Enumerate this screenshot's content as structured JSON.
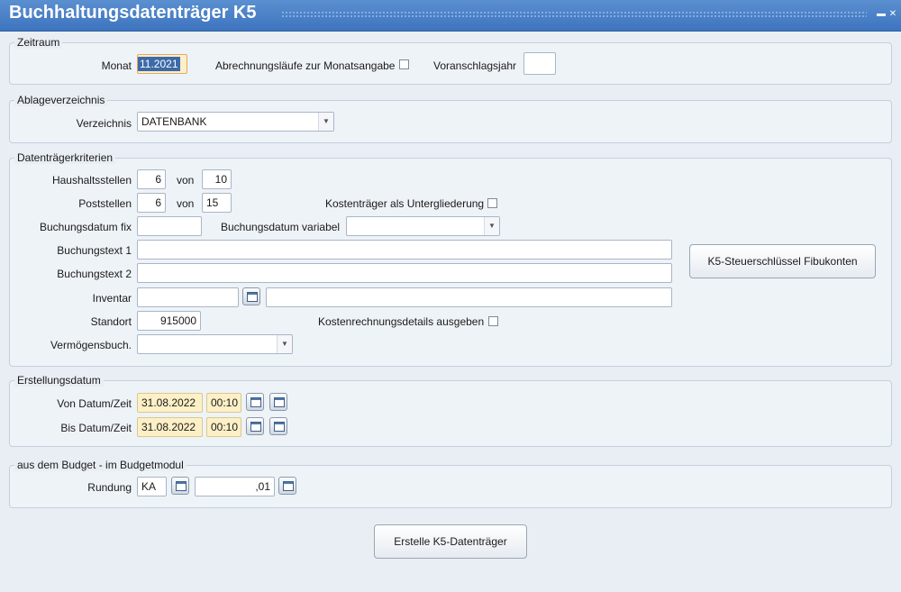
{
  "window": {
    "title": "Buchhaltungsdatenträger K5",
    "minimize_icon": "minimize-icon",
    "close_icon": "close-icon"
  },
  "zeitraum": {
    "legend": "Zeitraum",
    "monat_label": "Monat",
    "monat_value": "11.2021",
    "abrechnungslaeufe_label": "Abrechnungsläufe zur Monatsangabe",
    "voranschlagsjahr_label": "Voranschlagsjahr",
    "voranschlagsjahr_value": ""
  },
  "ablage": {
    "legend": "Ablageverzeichnis",
    "verzeichnis_label": "Verzeichnis",
    "verzeichnis_value": "DATENBANK"
  },
  "kriterien": {
    "legend": "Datenträgerkriterien",
    "haushaltsstellen_label": "Haushaltsstellen",
    "haushaltsstellen_from": "6",
    "von1": "von",
    "haushaltsstellen_to": "10",
    "poststellen_label": "Poststellen",
    "poststellen_from": "6",
    "von2": "von",
    "poststellen_to": "15",
    "kostentraeger_label": "Kostenträger als Untergliederung",
    "buchungsdatum_fix_label": "Buchungsdatum fix",
    "buchungsdatum_fix_value": "",
    "buchungsdatum_variabel_label": "Buchungsdatum variabel",
    "buchungsdatum_variabel_value": "",
    "buchungstext1_label": "Buchungstext 1",
    "buchungstext1_value": "",
    "buchungstext2_label": "Buchungstext 2",
    "buchungstext2_value": "",
    "inventar_label": "Inventar",
    "inventar_value": "",
    "inventar_desc": "",
    "standort_label": "Standort",
    "standort_value": "915000",
    "kostenrechnung_label": "Kostenrechnungsdetails ausgeben",
    "vermoegens_label": "Vermögensbuch.",
    "vermoegens_value": "",
    "steuer_button": "K5-Steuerschlüssel Fibukonten"
  },
  "erstellung": {
    "legend": "Erstellungsdatum",
    "von_label": "Von Datum/Zeit",
    "von_date": "31.08.2022",
    "von_time": "00:10",
    "bis_label": "Bis Datum/Zeit",
    "bis_date": "31.08.2022",
    "bis_time": "00:10"
  },
  "budget": {
    "legend": "aus dem Budget - im Budgetmodul",
    "rundung_label": "Rundung",
    "rundung_code": "KA",
    "rundung_value": ",01"
  },
  "actions": {
    "create_button": "Erstelle K5-Datenträger"
  },
  "colors": {
    "titlebar": "#3e74bf",
    "highlight_field": "#fdf0c6",
    "selection": "#3d6aa8"
  }
}
